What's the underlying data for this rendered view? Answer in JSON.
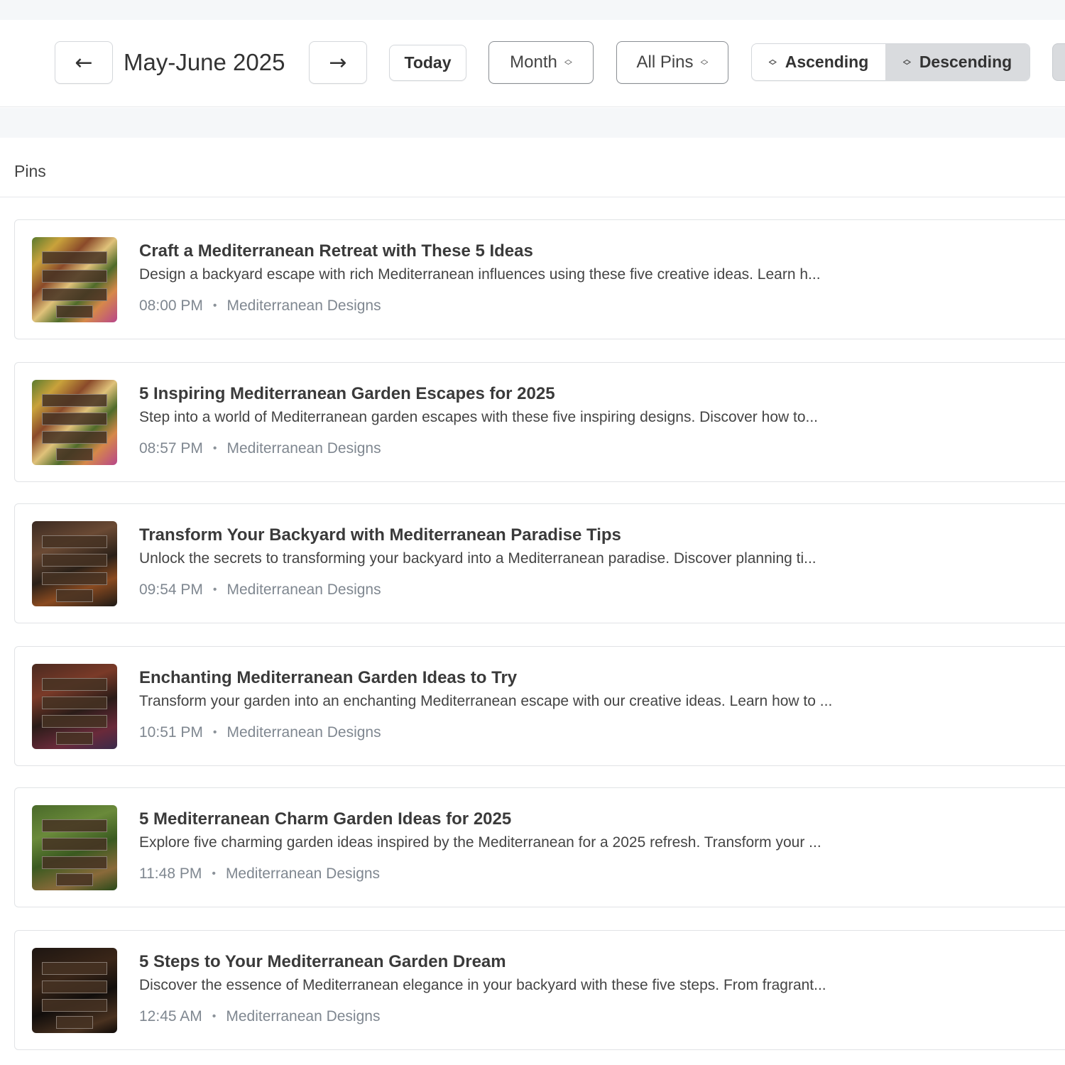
{
  "toolbar": {
    "prev_icon": "arrow-left-icon",
    "next_icon": "arrow-right-icon",
    "period_label": "May-June 2025",
    "today_label": "Today",
    "view_select": {
      "value": "Month",
      "icon": "up-down-chevron-icon"
    },
    "filter_select": {
      "value": "All Pins",
      "icon": "up-down-chevron-icon"
    },
    "sort": {
      "ascending_label": "Ascending",
      "descending_label": "Descending",
      "selected": "Descending"
    },
    "menu_icon": "more-icon"
  },
  "section": {
    "title": "Pins"
  },
  "pins": [
    {
      "title": "Craft a Mediterranean Retreat with These 5 Ideas",
      "description": "Design a backyard escape with rich Mediterranean influences using these five creative ideas. Learn h...",
      "time": "08:00 PM",
      "board": "Mediterranean Designs",
      "thumb": "garden-flowers-image"
    },
    {
      "title": "5 Inspiring Mediterranean Garden Escapes for 2025",
      "description": "Step into a world of Mediterranean garden escapes with these five inspiring designs. Discover how to...",
      "time": "08:57 PM",
      "board": "Mediterranean Designs",
      "thumb": "garden-flowers-image"
    },
    {
      "title": "Transform Your Backyard with Mediterranean Paradise Tips",
      "description": "Unlock the secrets to transforming your backyard into a Mediterranean paradise. Discover planning ti...",
      "time": "09:54 PM",
      "board": "Mediterranean Designs",
      "thumb": "garden-night-image"
    },
    {
      "title": "Enchanting Mediterranean Garden Ideas to Try",
      "description": "Transform your garden into an enchanting Mediterranean escape with our creative ideas. Learn how to ...",
      "time": "10:51 PM",
      "board": "Mediterranean Designs",
      "thumb": "garden-dusk-image"
    },
    {
      "title": "5 Mediterranean Charm Garden Ideas for 2025",
      "description": "Explore five charming garden ideas inspired by the Mediterranean for a 2025 refresh. Transform your ...",
      "time": "11:48 PM",
      "board": "Mediterranean Designs",
      "thumb": "garden-green-image"
    },
    {
      "title": "5 Steps to Your Mediterranean Garden Dream",
      "description": "Discover the essence of Mediterranean elegance in your backyard with these five steps. From fragrant...",
      "time": "12:45 AM",
      "board": "Mediterranean Designs",
      "thumb": "garden-dark-image"
    }
  ],
  "colors": {
    "accent_gray": "#d9dbde",
    "border": "#d4d7db",
    "meta_text": "#7f8790",
    "page_band": "#f5f7f9"
  }
}
